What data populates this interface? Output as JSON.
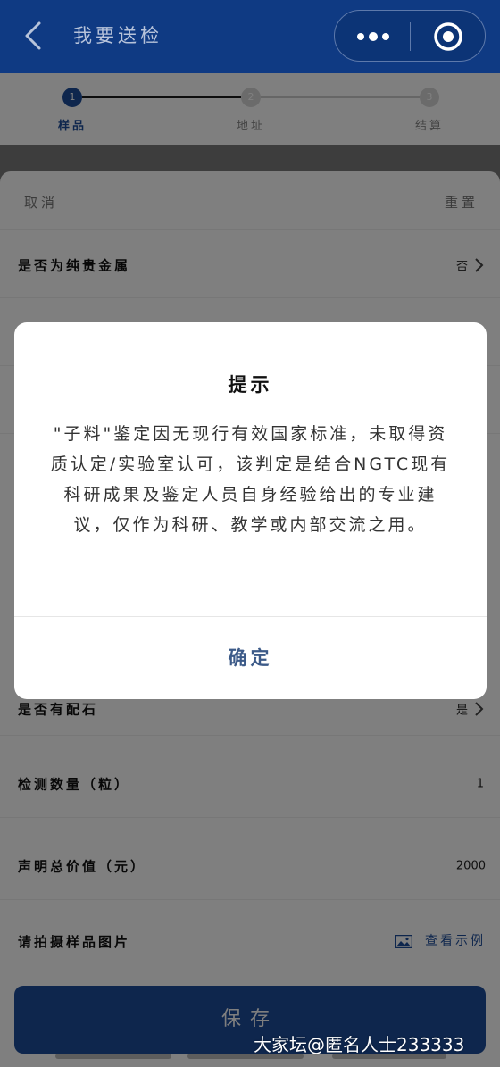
{
  "nav": {
    "title": "我要送检"
  },
  "steps": [
    {
      "num": "1",
      "label": "样品",
      "active": true
    },
    {
      "num": "2",
      "label": "地址",
      "active": false
    },
    {
      "num": "3",
      "label": "结算",
      "active": false
    }
  ],
  "sheet": {
    "cancel": "取消",
    "reset": "重置",
    "rows": [
      {
        "label": "是否为纯贵金属",
        "value": "否"
      },
      {
        "label": "是否有配石",
        "value": "是"
      },
      {
        "label": "检测数量（粒）",
        "value": "1"
      },
      {
        "label": "声明总价值（元）",
        "value": "2000"
      }
    ],
    "photo_label": "请拍摄样品图片",
    "photo_example": "查看示例",
    "save": "保存"
  },
  "dialog": {
    "title": "提示",
    "body": "\"子料\"鉴定因无现行有效国家标准，未取得资质认定/实验室认可，该判定是结合NGTC现有科研成果及鉴定人员自身经验给出的专业建议，仅作为科研、教学或内部交流之用。",
    "confirm": "确定"
  },
  "watermark": "大家坛@匿名人士233333",
  "colors": {
    "nav_bg": "#0f3a83",
    "primary": "#1d4c9a",
    "confirm_text": "#3c5a88"
  }
}
